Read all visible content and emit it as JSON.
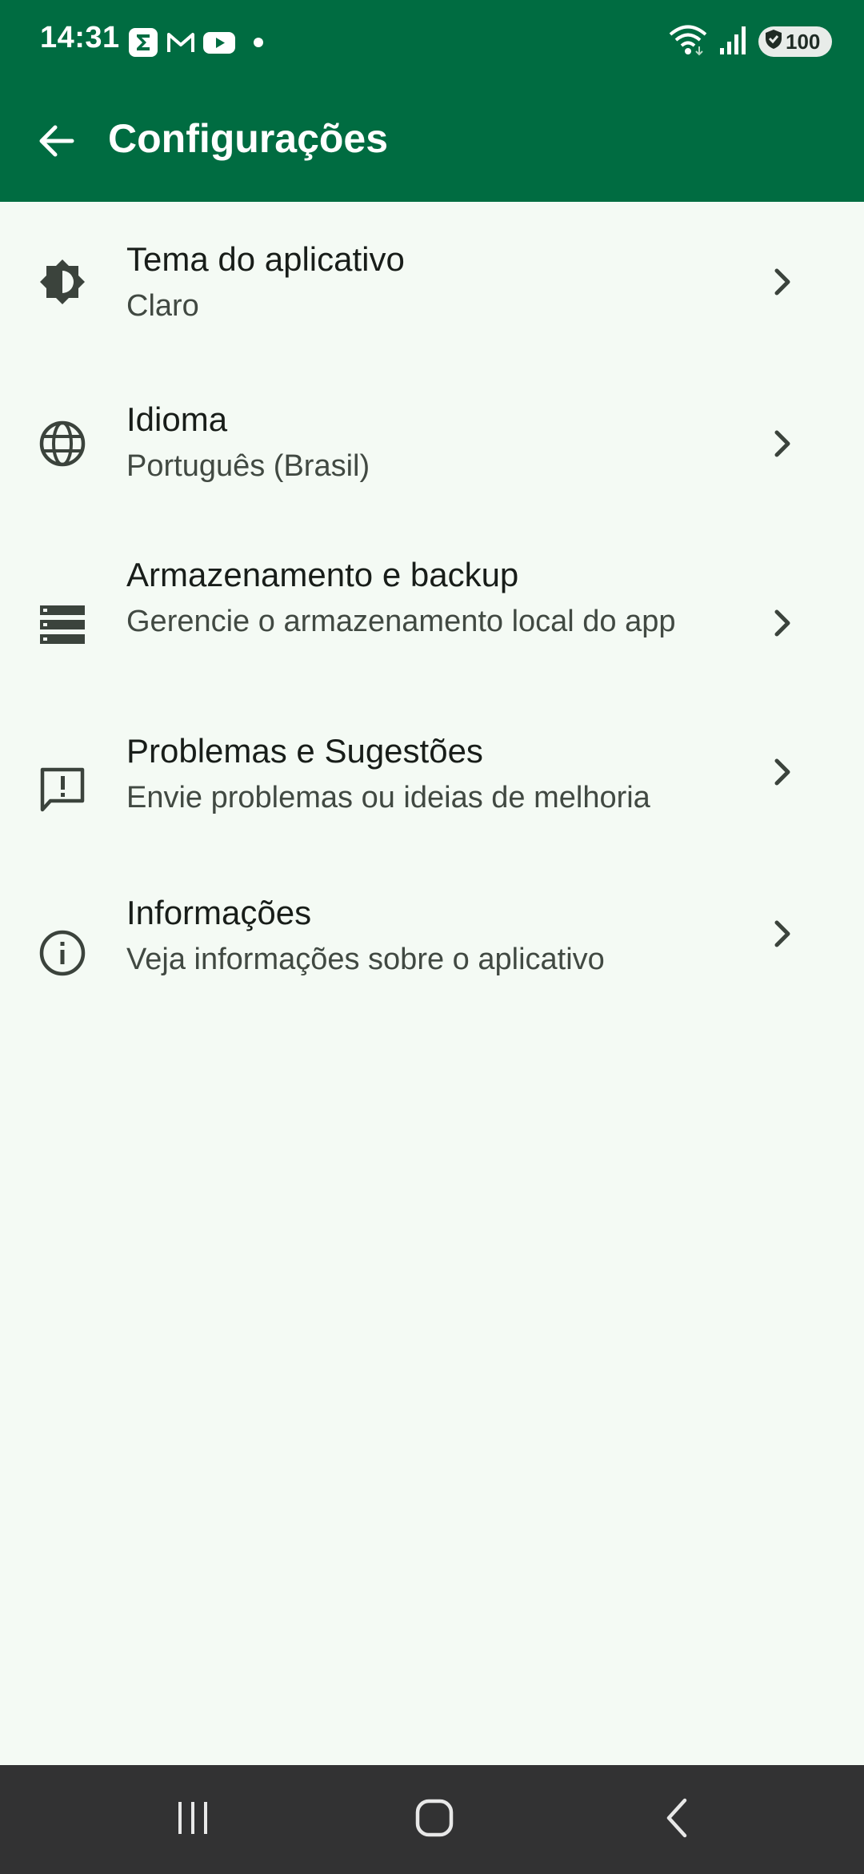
{
  "status_bar": {
    "time": "14:31",
    "battery": "100",
    "notification_icons": [
      "sigma-app-icon",
      "gmail-icon",
      "youtube-icon",
      "dot-icon"
    ],
    "system_icons": [
      "wifi-icon",
      "signal-icon",
      "battery-shield-icon"
    ]
  },
  "app_bar": {
    "title": "Configurações",
    "background": "#006c41"
  },
  "settings": [
    {
      "icon": "brightness-icon",
      "title": "Tema do aplicativo",
      "subtitle": "Claro"
    },
    {
      "icon": "globe-icon",
      "title": "Idioma",
      "subtitle": "Português (Brasil)"
    },
    {
      "icon": "storage-icon",
      "title": "Armazenamento e backup",
      "subtitle": "Gerencie o armazenamento local do app"
    },
    {
      "icon": "feedback-icon",
      "title": "Problemas e Sugestões",
      "subtitle": "Envie problemas ou ideias de melhoria"
    },
    {
      "icon": "info-icon",
      "title": "Informações",
      "subtitle": "Veja informações sobre o aplicativo"
    }
  ],
  "nav_bar": {
    "buttons": [
      "recents-icon",
      "home-icon",
      "back-icon"
    ]
  },
  "colors": {
    "primary": "#006c41",
    "background": "#f4faf4",
    "title_text": "#181d19",
    "subtitle_text": "#414942",
    "icon": "#3b433c",
    "nav_bar": "#323233"
  }
}
